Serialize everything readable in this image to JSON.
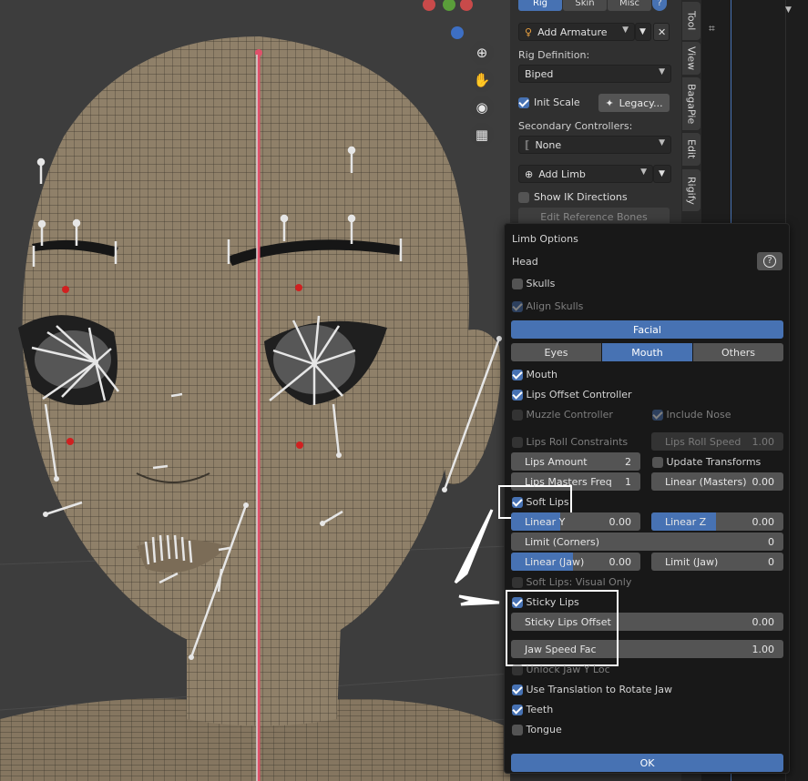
{
  "panel": {
    "tabs": [
      {
        "label": "Rig",
        "active": true
      },
      {
        "label": "Skin",
        "active": false
      },
      {
        "label": "Misc",
        "active": false
      }
    ],
    "add_armature": "Add Armature",
    "rig_definition_label": "Rig Definition:",
    "rig_definition_value": "Biped",
    "init_scale": "Init Scale",
    "legacy": "Legacy...",
    "secondary_label": "Secondary Controllers:",
    "secondary_value": "None",
    "add_limb": "Add Limb",
    "show_ik": "Show IK Directions",
    "edit_ref": "Edit Reference Bones"
  },
  "side_tabs": [
    "Tool",
    "View",
    "BagaPie",
    "Edit",
    "Rigify"
  ],
  "popup": {
    "title": "Limb Options",
    "limb": "Head",
    "skulls": "Skulls",
    "align_skulls": "Align Skulls",
    "facial": "Facial",
    "subtabs": [
      {
        "label": "Eyes",
        "active": false
      },
      {
        "label": "Mouth",
        "active": true
      },
      {
        "label": "Others",
        "active": false
      }
    ],
    "mouth": "Mouth",
    "lips_offset": "Lips Offset Controller",
    "muzzle": "Muzzle Controller",
    "include_nose": "Include Nose",
    "lips_roll": "Lips Roll Constraints",
    "lips_roll_speed": {
      "label": "Lips Roll Speed",
      "value": "1.00"
    },
    "lips_amount": {
      "label": "Lips Amount",
      "value": "2"
    },
    "update_transforms": "Update Transforms",
    "lips_masters_freq": {
      "label": "Lips Masters Freq",
      "value": "1"
    },
    "linear_masters": {
      "label": "Linear (Masters)",
      "value": "0.00"
    },
    "soft_lips": "Soft Lips",
    "linear_y": {
      "label": "Linear Y",
      "value": "0.00",
      "fill": 0.38
    },
    "linear_z": {
      "label": "Linear Z",
      "value": "0.00",
      "fill": 0.49
    },
    "limit_corners": {
      "label": "Limit (Corners)",
      "value": "0"
    },
    "linear_jaw": {
      "label": "Linear (Jaw)",
      "value": "0.00",
      "fill": 0.48
    },
    "limit_jaw": {
      "label": "Limit (Jaw)",
      "value": "0"
    },
    "soft_lips_visual": "Soft Lips: Visual Only",
    "sticky_lips": "Sticky Lips",
    "sticky_offset": {
      "label": "Sticky Lips Offset",
      "value": "0.00"
    },
    "jaw_speed": {
      "label": "Jaw Speed Fac",
      "value": "1.00"
    },
    "unlock_jaw": "Unlock Jaw Y Loc",
    "use_translation": "Use Translation to Rotate Jaw",
    "teeth": "Teeth",
    "tongue": "Tongue",
    "ok": "OK"
  },
  "colors": {
    "accent": "#4772b3",
    "axis_red": "#c84a4a",
    "axis_green": "#5a9e3a",
    "axis_blue": "#3d6fc4",
    "midline": "#e0506a"
  }
}
